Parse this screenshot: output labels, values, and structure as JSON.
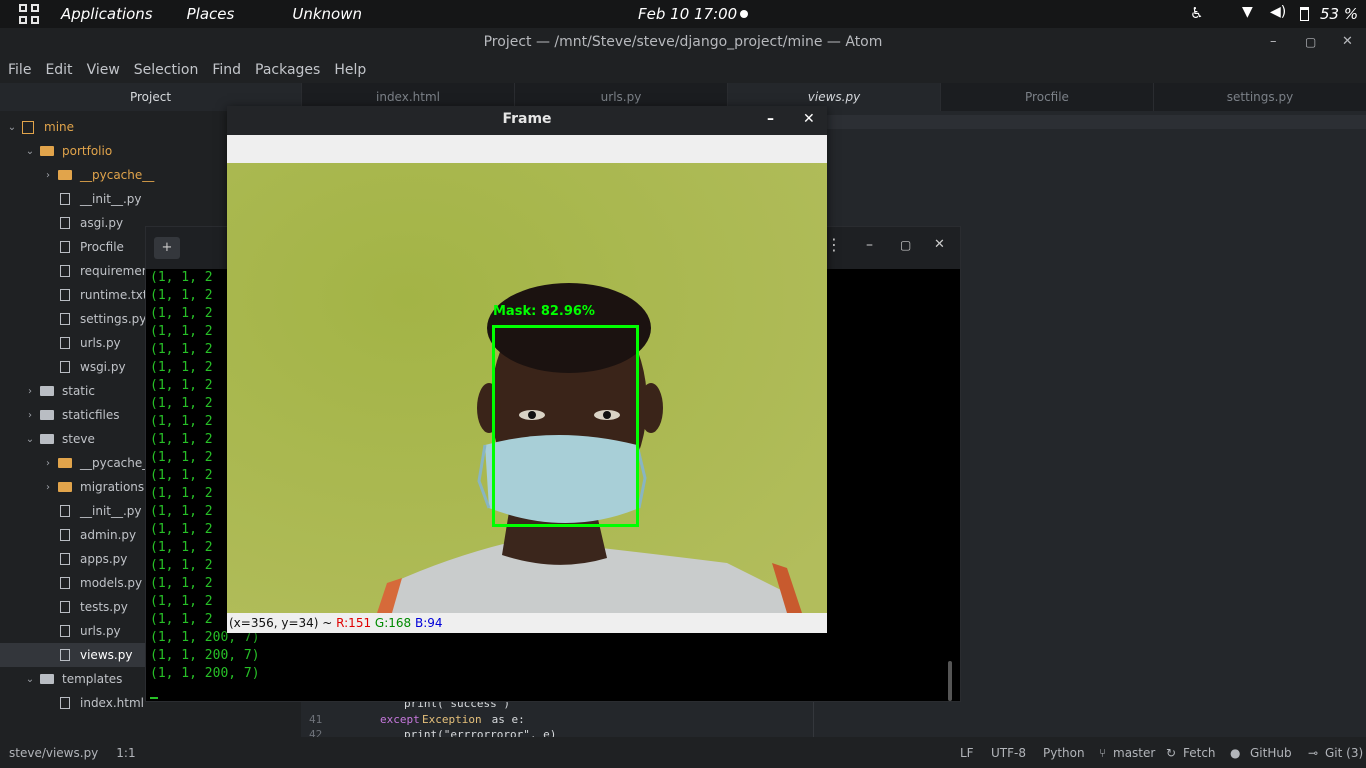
{
  "topbar": {
    "applications": "Applications",
    "places": "Places",
    "unknown": "Unknown",
    "clock": "Feb 10  17:00",
    "battery": "53 %"
  },
  "window": {
    "title": "Project — /mnt/Steve/steve/django_project/mine — Atom",
    "min": "–",
    "max": "▢",
    "close": "✕"
  },
  "menu": [
    "File",
    "Edit",
    "View",
    "Selection",
    "Find",
    "Packages",
    "Help"
  ],
  "tabs": {
    "project": "Project",
    "items": [
      "index.html",
      "urls.py",
      "views.py",
      "Procfile",
      "settings.py"
    ]
  },
  "tree": [
    {
      "label": "mine",
      "kind": "book",
      "chev": "⌄",
      "indent": 0
    },
    {
      "label": "portfolio",
      "kind": "folder-open",
      "chev": "⌄",
      "indent": 1
    },
    {
      "label": "__pycache__",
      "kind": "folder",
      "chev": "›",
      "indent": 2
    },
    {
      "label": "__init__.py",
      "kind": "file",
      "chev": "",
      "indent": 2
    },
    {
      "label": "asgi.py",
      "kind": "file",
      "chev": "",
      "indent": 2
    },
    {
      "label": "Procfile",
      "kind": "file",
      "chev": "",
      "indent": 2
    },
    {
      "label": "requirements",
      "kind": "file",
      "chev": "",
      "indent": 2
    },
    {
      "label": "runtime.txt",
      "kind": "file",
      "chev": "",
      "indent": 2
    },
    {
      "label": "settings.py",
      "kind": "file",
      "chev": "",
      "indent": 2
    },
    {
      "label": "urls.py",
      "kind": "file",
      "chev": "",
      "indent": 2
    },
    {
      "label": "wsgi.py",
      "kind": "file",
      "chev": "",
      "indent": 2
    },
    {
      "label": "static",
      "kind": "folder",
      "chev": "›",
      "indent": 1
    },
    {
      "label": "staticfiles",
      "kind": "folder",
      "chev": "›",
      "indent": 1
    },
    {
      "label": "steve",
      "kind": "folder",
      "chev": "⌄",
      "indent": 1
    },
    {
      "label": "__pycache__",
      "kind": "folder",
      "chev": "›",
      "indent": 2
    },
    {
      "label": "migrations",
      "kind": "folder",
      "chev": "›",
      "indent": 2
    },
    {
      "label": "__init__.py",
      "kind": "file",
      "chev": "",
      "indent": 2
    },
    {
      "label": "admin.py",
      "kind": "file",
      "chev": "",
      "indent": 2
    },
    {
      "label": "apps.py",
      "kind": "file",
      "chev": "",
      "indent": 2
    },
    {
      "label": "models.py",
      "kind": "file",
      "chev": "",
      "indent": 2
    },
    {
      "label": "tests.py",
      "kind": "file",
      "chev": "",
      "indent": 2
    },
    {
      "label": "urls.py",
      "kind": "file",
      "chev": "",
      "indent": 2
    },
    {
      "label": "views.py",
      "kind": "file",
      "chev": "",
      "indent": 2,
      "selected": true
    },
    {
      "label": "templates",
      "kind": "folder",
      "chev": "⌄",
      "indent": 1
    },
    {
      "label": "index.html",
      "kind": "file",
      "chev": "",
      "indent": 2
    }
  ],
  "code": {
    "line40": "print('success')",
    "ln41": "41",
    "line41a": "except ",
    "line41b": "Exception",
    "line41c": " as e:",
    "ln42": "42",
    "line42": "print(\"errrorroror\", e)"
  },
  "terminal": {
    "truncated_line": "(1, 1, 2",
    "truncated_count": 20,
    "full_lines": [
      "(1, 1, 200, 7)",
      "(1, 1, 200, 7)",
      "(1, 1, 200, 7)"
    ]
  },
  "frame": {
    "title": "Frame",
    "min": "–",
    "close": "✕",
    "label": "Mask: 82.96%",
    "coords": "(x=356, y=34) ~ ",
    "r": "R:151",
    "g": "G:168",
    "b": "B:94"
  },
  "status": {
    "path": "steve/views.py",
    "pos": "1:1",
    "lf": "LF",
    "enc": "UTF-8",
    "lang": "Python",
    "branch": "master",
    "fetch": "Fetch",
    "github": "GitHub",
    "git": "Git (3)"
  },
  "colors": {
    "accent_green": "#00ff00",
    "terminal_green": "#27c027",
    "folder_orange": "#e1a44b"
  }
}
